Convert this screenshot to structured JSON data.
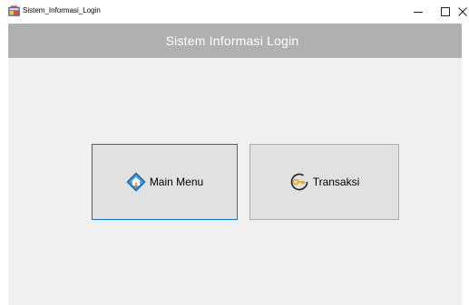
{
  "window": {
    "title": "Sistem_Informasi_Login",
    "minimize_glyph": "–",
    "maximize_glyph": "☐",
    "close_glyph": "✕"
  },
  "header": {
    "title": "Sistem Informasi Login"
  },
  "buttons": {
    "main_menu": {
      "label": "Main Menu",
      "icon": "home-diamond-icon"
    },
    "transaksi": {
      "label": "Transaksi",
      "icon": "key-icon"
    }
  },
  "colors": {
    "header_band": "#b0b0b0",
    "client_bg": "#f0f0f0",
    "tile_bg": "#e1e1e1",
    "focus_border": "#0078d7"
  }
}
